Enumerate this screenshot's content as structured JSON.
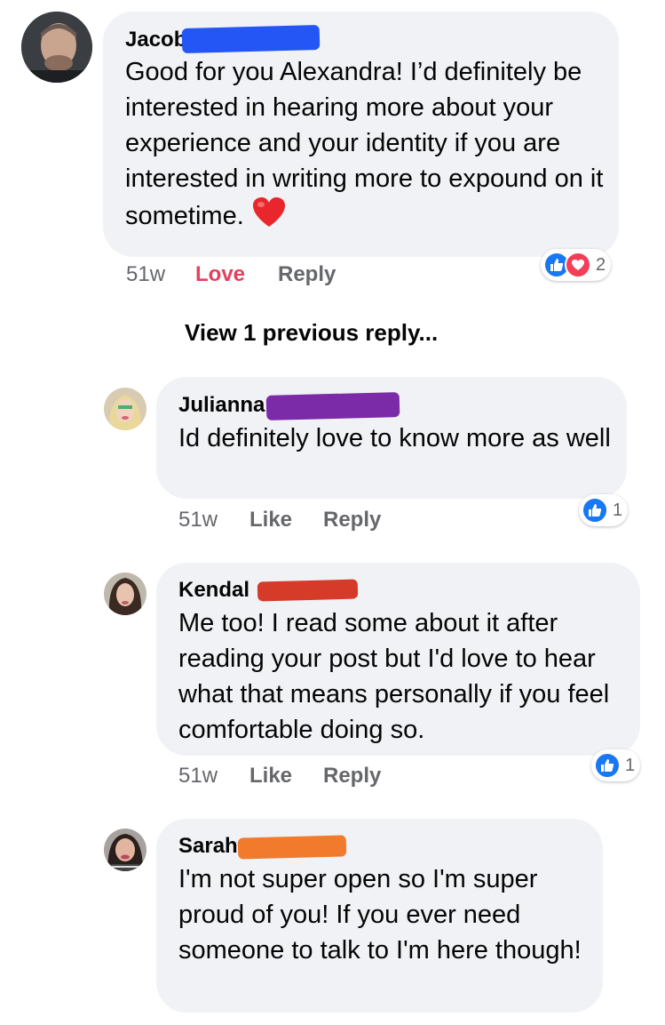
{
  "colors": {
    "bubble": "#f0f2f5",
    "meta_gray": "#65676b",
    "love_red": "#e4405f",
    "like_blue": "#1877f2",
    "redact_jacob": "#2456f5",
    "redact_julianna": "#7b2aa8",
    "redact_kendal": "#d63b2a",
    "redact_sarah": "#f27a2c"
  },
  "comments": [
    {
      "name": "Jacob",
      "text": "Good for you Alexandra! I’d definitely be interested in hearing more about your experience and your identity if you are interested in writing more to expound on it sometime.",
      "emoji": "heart-emoji",
      "time": "51w",
      "action": "Love",
      "reply": "Reply",
      "reactions": [
        "like-icon",
        "love-icon"
      ],
      "reaction_count": "2"
    },
    {
      "name": "Julianna",
      "text": "Id definitely love to know more as well",
      "time": "51w",
      "action": "Like",
      "reply": "Reply",
      "reactions": [
        "like-icon"
      ],
      "reaction_count": "1"
    },
    {
      "name": "Kendal",
      "text": "Me too! I read some about it after reading your post but I'd love to hear what that means personally if you feel comfortable doing so.",
      "time": "51w",
      "action": "Like",
      "reply": "Reply",
      "reactions": [
        "like-icon"
      ],
      "reaction_count": "1"
    },
    {
      "name": "Sarah",
      "text": "I'm not super open so I'm super proud of you! If you ever need someone to talk to I'm here though!"
    }
  ],
  "view_previous": "View 1 previous reply..."
}
